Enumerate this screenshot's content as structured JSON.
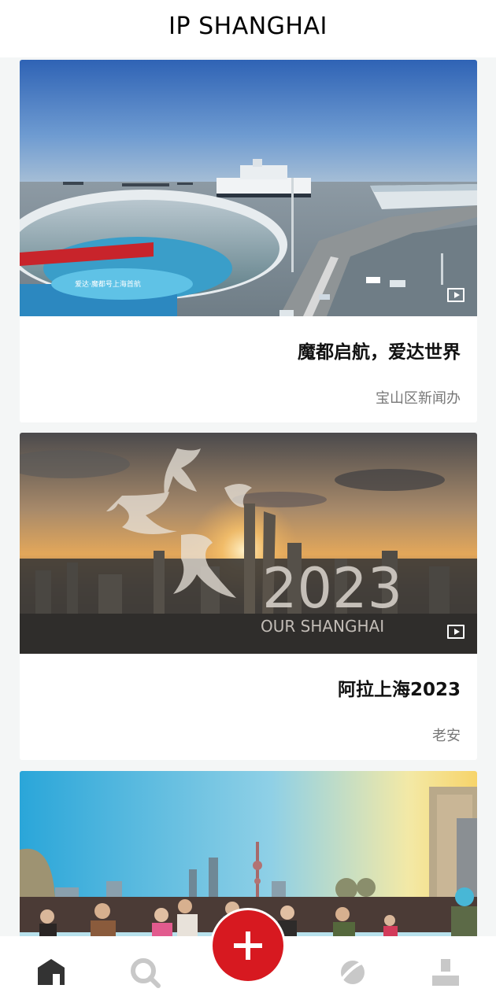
{
  "header": {
    "title": "IP SHANGHAI"
  },
  "feed": {
    "items": [
      {
        "title": "魔都启航，爱达世界",
        "source": "宝山区新闻办",
        "has_video": true,
        "image_subject": "cruise-terminal-aerial",
        "image_text": "爱达·魔都号上海首航"
      },
      {
        "title": "阿拉上海2023",
        "source": "老安",
        "has_video": true,
        "image_subject": "shanghai-skyline-sunrise",
        "image_overlay": {
          "year": "2023",
          "caption": "OUR SHANGHAI"
        }
      },
      {
        "title": "",
        "source": "",
        "has_video": false,
        "image_subject": "rooftop-crowd-skyline"
      }
    ]
  },
  "nav": {
    "items": [
      {
        "icon": "home-icon",
        "active": true
      },
      {
        "icon": "search-icon",
        "active": false
      },
      {
        "icon": "add-icon",
        "active": false
      },
      {
        "icon": "planet-icon",
        "active": false
      },
      {
        "icon": "profile-icon",
        "active": false
      }
    ]
  },
  "colors": {
    "accent": "#d71920",
    "background": "#f4f6f6",
    "nav_active": "#333333",
    "nav_inactive": "#c8c8c8"
  }
}
